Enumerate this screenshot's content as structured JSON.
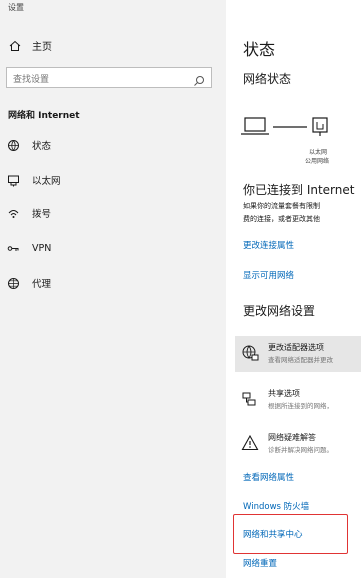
{
  "app_title": "设置",
  "sidebar": {
    "home_label": "主页",
    "search_placeholder": "查找设置",
    "section_title": "网络和 Internet",
    "items": [
      {
        "label": "状态",
        "icon": "globe-status-icon"
      },
      {
        "label": "以太网",
        "icon": "ethernet-icon"
      },
      {
        "label": "拨号",
        "icon": "dialup-icon"
      },
      {
        "label": "VPN",
        "icon": "vpn-icon"
      },
      {
        "label": "代理",
        "icon": "proxy-globe-icon"
      }
    ]
  },
  "main": {
    "title": "状态",
    "network_status_title": "网络状态",
    "diagram_label_1": "以太网",
    "diagram_label_2": "公用网络",
    "connected_heading": "你已连接到 Internet",
    "connected_desc_1": "如果你的流量套餐有限制",
    "connected_desc_2": "费的连接，或者更改其他",
    "link_change_connection": "更改连接属性",
    "link_show_networks": "显示可用网络",
    "change_settings_title": "更改网络设置",
    "options": [
      {
        "title": "更改适配器选项",
        "subtitle": "查看网络适配器并更改"
      },
      {
        "title": "共享选项",
        "subtitle": "根据所连接到的网络，"
      },
      {
        "title": "网络疑难解答",
        "subtitle": "诊断并解决网络问题。"
      }
    ],
    "link_view_properties": "查看网络属性",
    "link_firewall": "Windows 防火墙",
    "link_sharing_center": "网络和共享中心",
    "link_reset": "网络重置"
  },
  "colors": {
    "link": "#0067b8",
    "sidebar_bg": "#f2f2f2",
    "highlight_box": "#e03434"
  }
}
